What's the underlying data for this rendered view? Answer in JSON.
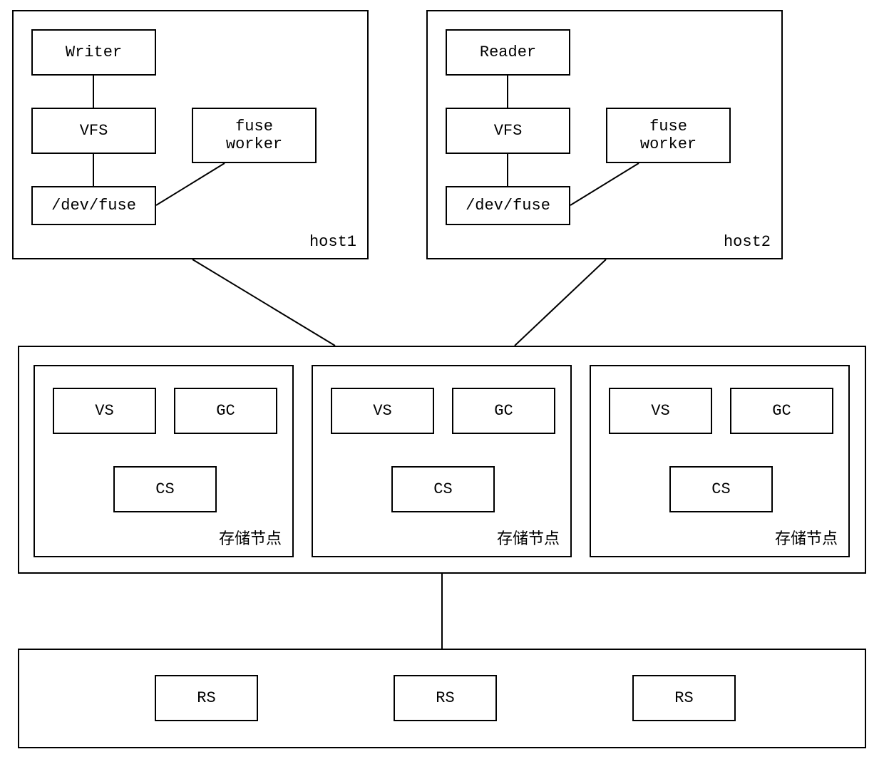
{
  "host1": {
    "label": "host1",
    "writer": "Writer",
    "vfs": "VFS",
    "devfuse": "/dev/fuse",
    "fuseworker_line1": "fuse",
    "fuseworker_line2": "worker"
  },
  "host2": {
    "label": "host2",
    "reader": "Reader",
    "vfs": "VFS",
    "devfuse": "/dev/fuse",
    "fuseworker_line1": "fuse",
    "fuseworker_line2": "worker"
  },
  "storage": {
    "vs": "VS",
    "gc": "GC",
    "cs": "CS",
    "node_label": "存储节点"
  },
  "rs": {
    "label": "RS"
  }
}
